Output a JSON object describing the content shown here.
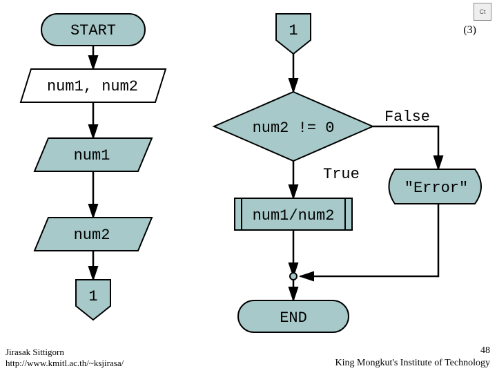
{
  "slide_marker": "(3)",
  "left": {
    "start": "START",
    "input": "num1, num2",
    "output1": "num1",
    "output2": "num2",
    "connector": "1"
  },
  "right": {
    "connector_in": "1",
    "decision": "num2 != 0",
    "branch_true": "True",
    "branch_false": "False",
    "process": "num1/num2",
    "error": "\"Error\"",
    "end": "END"
  },
  "footer": {
    "author": "Jirasak Sittigorn",
    "url": "http://www.kmitl.ac.th/~ksjirasa/",
    "page_number": "48",
    "institution": "King Mongkut's Institute of Technology"
  },
  "badge": "Ct"
}
